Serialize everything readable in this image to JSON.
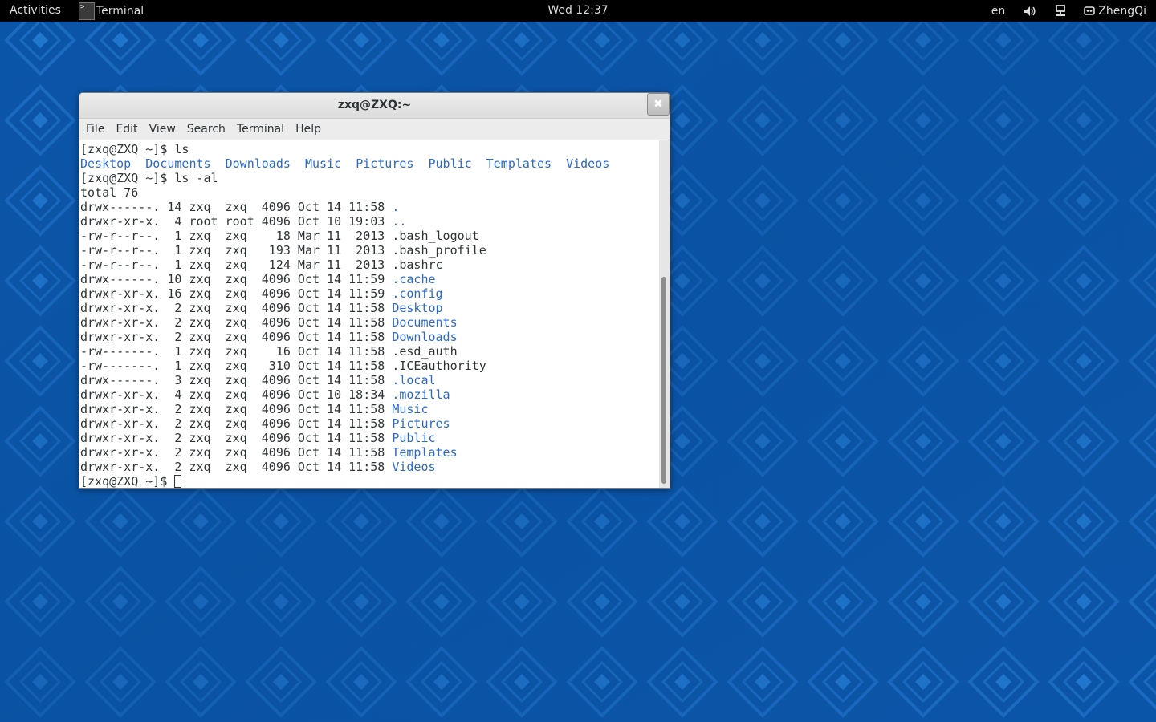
{
  "topbar": {
    "activities": "Activities",
    "app_name": "Terminal",
    "clock": "Wed 12:37",
    "language": "en",
    "user": "ZhengQi"
  },
  "window": {
    "title": "zxq@ZXQ:~",
    "close_glyph": "✖",
    "menu": [
      "File",
      "Edit",
      "View",
      "Search",
      "Terminal",
      "Help"
    ]
  },
  "terminal": {
    "lines": [
      [
        {
          "t": "[zxq@ZXQ ~]$ ls"
        }
      ],
      [
        {
          "t": "Desktop",
          "c": "blue"
        },
        {
          "t": "  "
        },
        {
          "t": "Documents",
          "c": "blue"
        },
        {
          "t": "  "
        },
        {
          "t": "Downloads",
          "c": "blue"
        },
        {
          "t": "  "
        },
        {
          "t": "Music",
          "c": "blue"
        },
        {
          "t": "  "
        },
        {
          "t": "Pictures",
          "c": "blue"
        },
        {
          "t": "  "
        },
        {
          "t": "Public",
          "c": "blue"
        },
        {
          "t": "  "
        },
        {
          "t": "Templates",
          "c": "blue"
        },
        {
          "t": "  "
        },
        {
          "t": "Videos",
          "c": "blue"
        }
      ],
      [
        {
          "t": "[zxq@ZXQ ~]$ ls -al"
        }
      ],
      [
        {
          "t": "total 76"
        }
      ],
      [
        {
          "t": "drwx------. 14 zxq  zxq  4096 Oct 14 11:58 "
        },
        {
          "t": ".",
          "c": "blue"
        }
      ],
      [
        {
          "t": "drwxr-xr-x.  4 root root 4096 Oct 10 19:03 "
        },
        {
          "t": "..",
          "c": "blue"
        }
      ],
      [
        {
          "t": "-rw-r--r--.  1 zxq  zxq    18 Mar 11  2013 .bash_logout"
        }
      ],
      [
        {
          "t": "-rw-r--r--.  1 zxq  zxq   193 Mar 11  2013 .bash_profile"
        }
      ],
      [
        {
          "t": "-rw-r--r--.  1 zxq  zxq   124 Mar 11  2013 .bashrc"
        }
      ],
      [
        {
          "t": "drwx------. 10 zxq  zxq  4096 Oct 14 11:59 "
        },
        {
          "t": ".cache",
          "c": "blue"
        }
      ],
      [
        {
          "t": "drwxr-xr-x. 16 zxq  zxq  4096 Oct 14 11:59 "
        },
        {
          "t": ".config",
          "c": "blue"
        }
      ],
      [
        {
          "t": "drwxr-xr-x.  2 zxq  zxq  4096 Oct 14 11:58 "
        },
        {
          "t": "Desktop",
          "c": "blue"
        }
      ],
      [
        {
          "t": "drwxr-xr-x.  2 zxq  zxq  4096 Oct 14 11:58 "
        },
        {
          "t": "Documents",
          "c": "blue"
        }
      ],
      [
        {
          "t": "drwxr-xr-x.  2 zxq  zxq  4096 Oct 14 11:58 "
        },
        {
          "t": "Downloads",
          "c": "blue"
        }
      ],
      [
        {
          "t": "-rw-------.  1 zxq  zxq    16 Oct 14 11:58 .esd_auth"
        }
      ],
      [
        {
          "t": "-rw-------.  1 zxq  zxq   310 Oct 14 11:58 .ICEauthority"
        }
      ],
      [
        {
          "t": "drwx------.  3 zxq  zxq  4096 Oct 14 11:58 "
        },
        {
          "t": ".local",
          "c": "blue"
        }
      ],
      [
        {
          "t": "drwxr-xr-x.  4 zxq  zxq  4096 Oct 10 18:34 "
        },
        {
          "t": ".mozilla",
          "c": "blue"
        }
      ],
      [
        {
          "t": "drwxr-xr-x.  2 zxq  zxq  4096 Oct 14 11:58 "
        },
        {
          "t": "Music",
          "c": "blue"
        }
      ],
      [
        {
          "t": "drwxr-xr-x.  2 zxq  zxq  4096 Oct 14 11:58 "
        },
        {
          "t": "Pictures",
          "c": "blue"
        }
      ],
      [
        {
          "t": "drwxr-xr-x.  2 zxq  zxq  4096 Oct 14 11:58 "
        },
        {
          "t": "Public",
          "c": "blue"
        }
      ],
      [
        {
          "t": "drwxr-xr-x.  2 zxq  zxq  4096 Oct 14 11:58 "
        },
        {
          "t": "Templates",
          "c": "blue"
        }
      ],
      [
        {
          "t": "drwxr-xr-x.  2 zxq  zxq  4096 Oct 14 11:58 "
        },
        {
          "t": "Videos",
          "c": "blue"
        }
      ]
    ],
    "prompt": "[zxq@ZXQ ~]$ "
  },
  "icons": {
    "app": "terminal-icon",
    "volume": "volume-icon",
    "network": "network-icon",
    "user": "user-icon",
    "close": "close-icon"
  },
  "colors": {
    "desktop_bg": "#0b55a8",
    "topbar_bg": "#000000",
    "dir_blue": "#2b6acb",
    "terminal_fg": "#2e3436"
  }
}
